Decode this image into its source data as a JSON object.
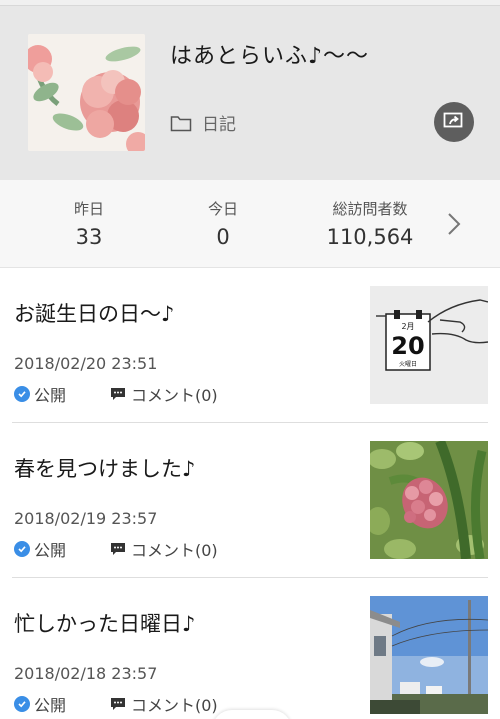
{
  "header": {
    "blog_title": "はあとらいふ♪〜〜",
    "category_label": "日記"
  },
  "stats": {
    "yesterday_label": "昨日",
    "yesterday_value": "33",
    "today_label": "今日",
    "today_value": "0",
    "total_label": "総訪問者数",
    "total_value": "110,564"
  },
  "entries": [
    {
      "title": "お誕生日の日〜♪",
      "date": "2018/02/20 23:51",
      "status": "公開",
      "comments": "コメント(0)",
      "thumb": {
        "month": "2月",
        "day": "20",
        "weekday": "火曜日"
      }
    },
    {
      "title": "春を見つけました♪",
      "date": "2018/02/19 23:57",
      "status": "公開",
      "comments": "コメント(0)"
    },
    {
      "title": "忙しかった日曜日♪",
      "date": "2018/02/18 23:57",
      "status": "公開",
      "comments": "コメント(0)"
    }
  ],
  "colors": {
    "header_bg": "#e7e7e7",
    "stats_bg": "#f7f7f7",
    "check_blue": "#3a8ee6",
    "share_button": "#5e5e5e"
  }
}
